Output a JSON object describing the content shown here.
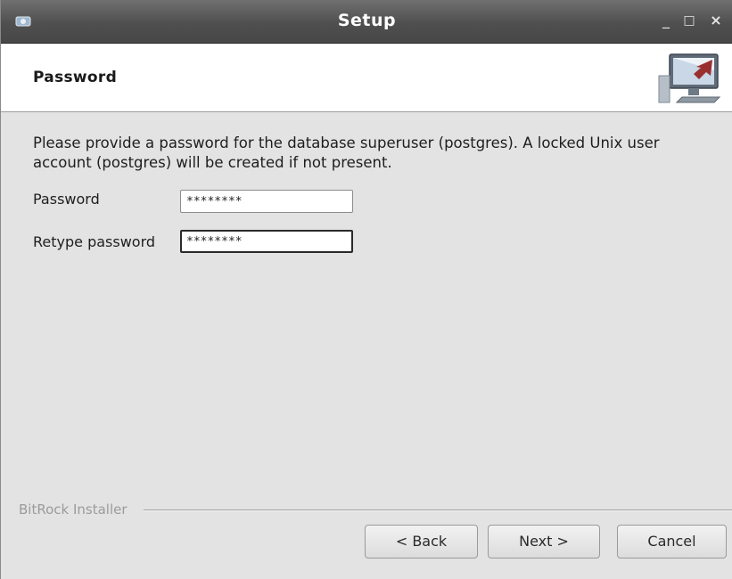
{
  "window": {
    "title": "Setup",
    "controls": {
      "minimize_icon": "minimize-icon",
      "maximize_icon": "maximize-icon",
      "close_icon": "close-icon",
      "minimize_glyph": "_",
      "maximize_glyph": "□",
      "close_glyph": "×"
    }
  },
  "header": {
    "title": "Password",
    "graphic_icon": "installer-computer-icon"
  },
  "content": {
    "description": "Please provide a password for the database superuser (postgres). A locked Unix user account (postgres) will be created if not present.",
    "fields": [
      {
        "label": "Password",
        "value": "********"
      },
      {
        "label": "Retype password",
        "value": "********"
      }
    ]
  },
  "footer": {
    "branding": "BitRock Installer",
    "buttons": {
      "back": "< Back",
      "next": "Next >",
      "cancel": "Cancel"
    }
  },
  "colors": {
    "titlebar": "#4f4f4f",
    "window_bg": "#e3e3e3",
    "header_bg": "#ffffff"
  }
}
